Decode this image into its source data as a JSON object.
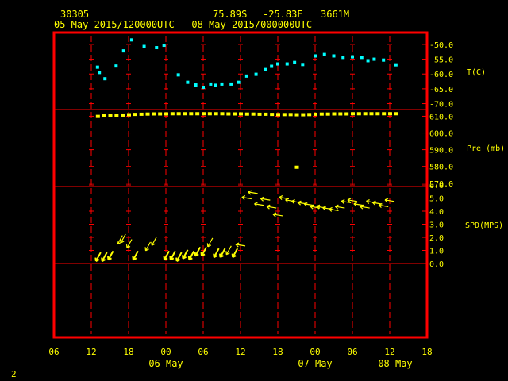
{
  "header": {
    "station": "30305",
    "latitude": "75.89S",
    "longitude": "-25.83E",
    "elevation": "3661M",
    "time_range": "05 May 2015/120000UTC - 08 May 2015/000000UTC"
  },
  "footer": {
    "page_number": "2"
  },
  "colors": {
    "background": "#000000",
    "frame": "#ff0000",
    "text": "#ffff00",
    "temperature": "#00ffff",
    "pressure": "#ffff00",
    "wind": "#ffff00"
  },
  "chart_data": [
    {
      "type": "scatter",
      "panel": "temperature",
      "ylabel": "T(C)",
      "ylim": [
        -72,
        -46
      ],
      "y_ticks": [
        "-50.0",
        "-55.0",
        "-60.0",
        "-65.0",
        "-70.0"
      ],
      "y_tick_values": [
        -50,
        -55,
        -60,
        -65,
        -70
      ],
      "x": [
        13.0,
        13.3,
        14.2,
        16.0,
        17.2,
        18.5,
        20.5,
        22.5,
        23.7,
        26.0,
        27.5,
        28.8,
        30.0,
        31.2,
        32.0,
        33.0,
        34.5,
        35.7,
        37.0,
        38.5,
        40.0,
        41.0,
        42.0,
        43.5,
        44.7,
        46.0,
        48.0,
        49.5,
        51.0,
        52.5,
        54.0,
        55.5,
        56.5,
        57.5,
        59.0,
        61.0
      ],
      "values": [
        -57.7,
        -59.5,
        -61.6,
        -57.3,
        -52.2,
        -48.5,
        -50.7,
        -51.1,
        -50.3,
        -60.3,
        -62.8,
        -63.7,
        -64.5,
        -63.4,
        -63.8,
        -63.4,
        -63.4,
        -62.8,
        -60.7,
        -60.1,
        -58.5,
        -57.4,
        -56.6,
        -56.6,
        -56.1,
        -56.8,
        -53.9,
        -53.4,
        -53.9,
        -54.4,
        -54.2,
        -54.4,
        -55.5,
        -55.0,
        -55.3,
        -56.9
      ]
    },
    {
      "type": "scatter",
      "panel": "pressure",
      "ylabel": "Pre (mb)",
      "ylim": [
        568,
        614
      ],
      "y_ticks": [
        "610.0",
        "600.0",
        "590.0",
        "580.0",
        "570.0"
      ],
      "y_tick_values": [
        610,
        600,
        590,
        580,
        570
      ],
      "x": [
        13,
        14,
        15,
        16,
        17,
        18,
        19,
        20,
        21,
        22,
        23,
        24,
        25,
        26,
        27,
        28,
        29,
        30,
        31,
        32,
        33,
        34,
        35,
        36,
        37,
        38,
        39,
        40,
        41,
        42,
        43,
        44,
        45,
        46,
        47,
        48,
        49,
        50,
        51,
        52,
        53,
        54,
        55,
        56,
        57,
        58,
        59,
        60,
        61
      ],
      "values": [
        609.9,
        610.2,
        610.3,
        610.5,
        610.7,
        610.9,
        611.1,
        611.2,
        611.3,
        611.4,
        611.4,
        611.4,
        611.5,
        611.5,
        611.5,
        611.5,
        611.5,
        611.5,
        611.5,
        611.5,
        611.5,
        611.4,
        611.4,
        611.4,
        611.3,
        611.3,
        611.2,
        611.2,
        611.1,
        611.0,
        611.0,
        611.0,
        610.9,
        610.9,
        611.0,
        611.2,
        611.3,
        611.3,
        611.4,
        611.4,
        611.4,
        611.5,
        611.5,
        611.5,
        611.5,
        611.5,
        611.5,
        611.5,
        611.5
      ],
      "outlier": {
        "x": 45,
        "value": 579.5
      }
    },
    {
      "type": "wind_barbs",
      "panel": "wind",
      "ylabel": "SPD(MPS)",
      "ylim": [
        0,
        6.4
      ],
      "y_ticks": [
        "6.0",
        "5.0",
        "4.0",
        "3.0",
        "2.0",
        "1.0",
        "0.0"
      ],
      "y_tick_values": [
        6,
        5,
        4,
        3,
        2,
        1,
        0
      ],
      "x": [
        13,
        14,
        15,
        16.5,
        17,
        18,
        19,
        21,
        22,
        24,
        25,
        26,
        27,
        28,
        29,
        30,
        31,
        32,
        33,
        34,
        35,
        36,
        37,
        38,
        39,
        40,
        41,
        42,
        43,
        44,
        45,
        46,
        47,
        48,
        49,
        50,
        51,
        52,
        53,
        54,
        55,
        56,
        57,
        58,
        59,
        60
      ],
      "values": [
        0.3,
        0.3,
        0.4,
        1.6,
        1.7,
        1.3,
        0.4,
        1.1,
        1.5,
        0.4,
        0.4,
        0.3,
        0.5,
        0.4,
        0.7,
        0.7,
        1.4,
        0.6,
        0.6,
        0.8,
        0.6,
        1.4,
        5.0,
        5.4,
        4.5,
        4.9,
        4.3,
        3.7,
        5.0,
        4.8,
        4.7,
        4.6,
        4.5,
        4.3,
        4.3,
        4.2,
        4.1,
        4.3,
        4.7,
        4.8,
        4.5,
        4.3,
        4.7,
        4.6,
        4.4,
        4.8
      ]
    }
  ],
  "x_axis": {
    "range_hours": [
      6,
      66
    ],
    "tick_hours": [
      6,
      12,
      18,
      24,
      30,
      36,
      42,
      48,
      54,
      60,
      66
    ],
    "tick_labels": [
      "06",
      "12",
      "18",
      "00",
      "06",
      "12",
      "18",
      "00",
      "06",
      "12",
      "18",
      "00",
      "06"
    ],
    "tick_label_hours": [
      6,
      12,
      18,
      24,
      30,
      36,
      42,
      48,
      54,
      60,
      66
    ],
    "date_labels": [
      "06 May",
      "07 May",
      "08 May"
    ],
    "date_label_hours": [
      24,
      48,
      72
    ]
  }
}
